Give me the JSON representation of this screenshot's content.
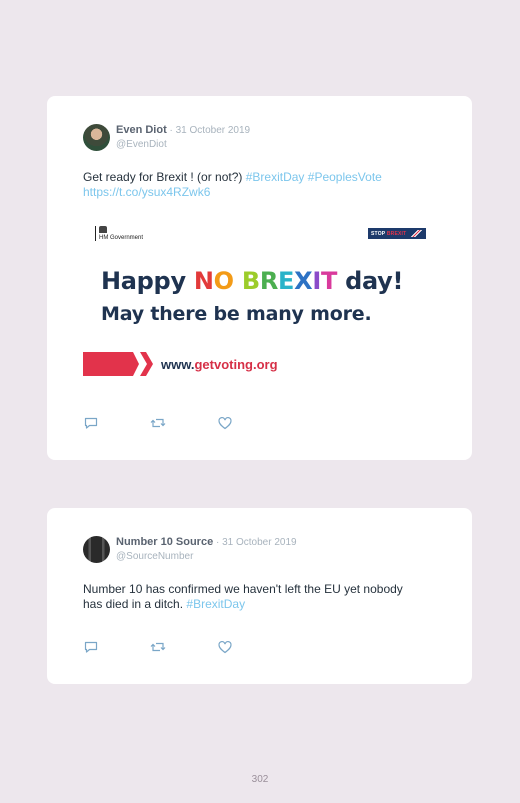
{
  "tweets": [
    {
      "name": "Even Diot",
      "date": " · 31 October 2019",
      "handle": "@EvenDiot",
      "text": "Get ready for Brexit ! (or not?) ",
      "tag1": "#BrexitDay",
      "tag2": "#PeoplesVote",
      "link": "https://t.co/ysux4RZwk6",
      "media": {
        "gov_label": "HM Government",
        "stop_label_1": "STOP",
        "stop_label_2": "BREXIT",
        "headline_start": "Happy ",
        "headline_letters": [
          "N",
          "O",
          " ",
          "B",
          "R",
          "E",
          "X",
          "I",
          "T"
        ],
        "headline_end": " day!",
        "subheadline": "May there be many more.",
        "website_prefix": "www.",
        "website_main": "getvoting.org"
      }
    },
    {
      "name": "Number 10 Source",
      "date": " · 31 October 2019",
      "handle": "@SourceNumber",
      "text_line1": "Number 10 has confirmed we haven't left the EU yet nobody",
      "text_line2": "has died in a ditch. ",
      "tag1": "#BrexitDay"
    }
  ],
  "icons": [
    "reply-icon",
    "retweet-icon",
    "like-icon"
  ],
  "colors": {
    "hashtag": "#7cc6ec",
    "background": "#ede7ed",
    "accent_red": "#d63047",
    "navy": "#1f3350"
  },
  "page_number": "302"
}
